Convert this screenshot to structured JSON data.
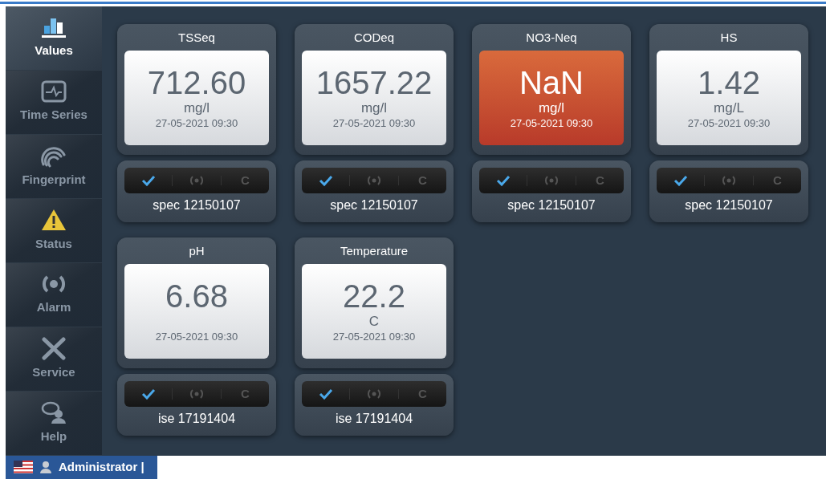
{
  "sidebar": {
    "items": [
      {
        "label": "Values",
        "selected": true
      },
      {
        "label": "Time Series",
        "selected": false
      },
      {
        "label": "Fingerprint",
        "selected": false
      },
      {
        "label": "Status",
        "selected": false
      },
      {
        "label": "Alarm",
        "selected": false
      },
      {
        "label": "Service",
        "selected": false
      },
      {
        "label": "Help",
        "selected": false
      }
    ]
  },
  "tiles": [
    {
      "title": "TSSeq",
      "value": "712.60",
      "unit": "mg/l",
      "time": "27-05-2021 09:30",
      "alarm": false,
      "ok": true,
      "alarm_on": false,
      "cal_label": "C",
      "sensor": "spec 12150107"
    },
    {
      "title": "CODeq",
      "value": "1657.22",
      "unit": "mg/l",
      "time": "27-05-2021 09:30",
      "alarm": false,
      "ok": true,
      "alarm_on": false,
      "cal_label": "C",
      "sensor": "spec 12150107"
    },
    {
      "title": "NO3-Neq",
      "value": "NaN",
      "unit": "mg/l",
      "time": "27-05-2021 09:30",
      "alarm": true,
      "ok": true,
      "alarm_on": false,
      "cal_label": "C",
      "sensor": "spec 12150107"
    },
    {
      "title": "HS",
      "value": "1.42",
      "unit": "mg/L",
      "time": "27-05-2021 09:30",
      "alarm": false,
      "ok": true,
      "alarm_on": false,
      "cal_label": "C",
      "sensor": "spec 12150107"
    },
    {
      "title": "pH",
      "value": "6.68",
      "time": "27-05-2021 09:30",
      "alarm": false,
      "ok": true,
      "alarm_on": false,
      "cal_label": "C",
      "sensor": "ise 17191404"
    },
    {
      "title": "Temperature",
      "value": "22.2",
      "unit": "C",
      "time": "27-05-2021 09:30",
      "alarm": false,
      "ok": true,
      "alarm_on": false,
      "cal_label": "C",
      "sensor": "ise 17191404"
    }
  ],
  "status_bar": {
    "user": "Administrator |"
  }
}
